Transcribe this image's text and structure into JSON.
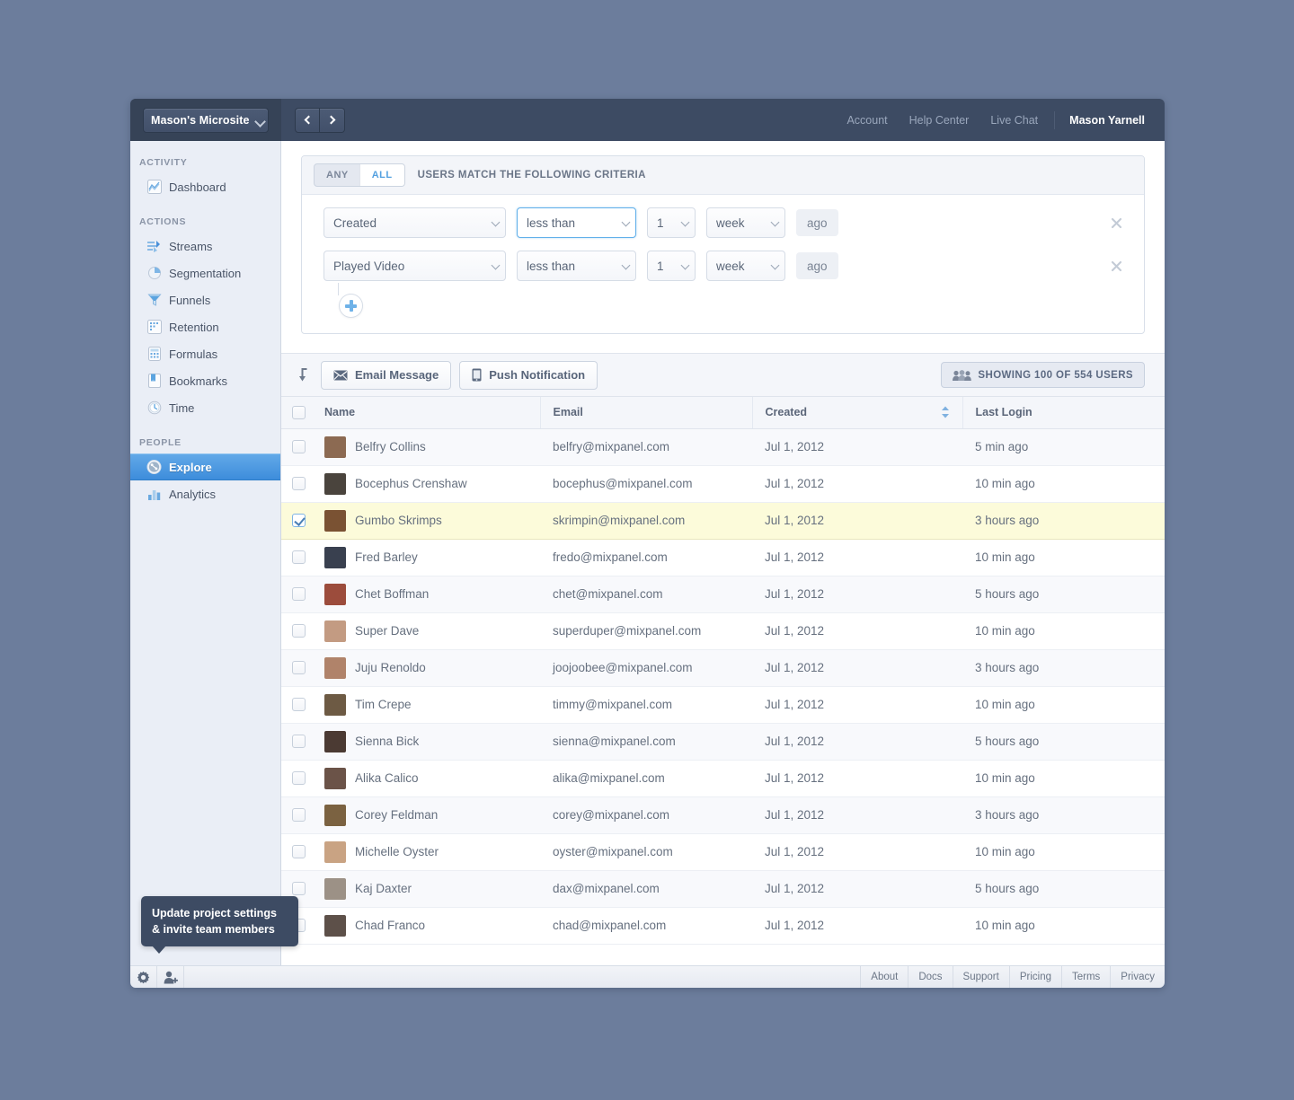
{
  "topbar": {
    "project_name": "Mason's Microsite",
    "nav_links": [
      "Account",
      "Help Center",
      "Live Chat"
    ],
    "user_name": "Mason Yarnell",
    "prev_icon": "chevron-left-icon",
    "next_icon": "chevron-right-icon"
  },
  "sidebar": {
    "groups": [
      {
        "title": "ACTIVITY",
        "items": [
          {
            "label": "Dashboard",
            "icon": "dashboard-chart-icon",
            "active": false
          }
        ]
      },
      {
        "title": "ACTIONS",
        "items": [
          {
            "label": "Streams",
            "icon": "streams-icon",
            "active": false
          },
          {
            "label": "Segmentation",
            "icon": "pie-chart-icon",
            "active": false
          },
          {
            "label": "Funnels",
            "icon": "funnel-icon",
            "active": false
          },
          {
            "label": "Retention",
            "icon": "grid-icon",
            "active": false
          },
          {
            "label": "Formulas",
            "icon": "calculator-icon",
            "active": false
          },
          {
            "label": "Bookmarks",
            "icon": "bookmark-icon",
            "active": false
          },
          {
            "label": "Time",
            "icon": "clock-icon",
            "active": false
          }
        ]
      },
      {
        "title": "PEOPLE",
        "items": [
          {
            "label": "Explore",
            "icon": "explore-icon",
            "active": true
          },
          {
            "label": "Analytics",
            "icon": "bar-chart-icon",
            "active": false
          }
        ]
      }
    ]
  },
  "criteria": {
    "match_any_label": "ANY",
    "match_all_label": "ALL",
    "selected_match": "ALL",
    "headline": "USERS MATCH THE FOLLOWING CRITERIA",
    "add_icon": "plus-icon",
    "remove_icon": "close-icon",
    "rows": [
      {
        "property": "Created",
        "operator": "less than",
        "number": "1",
        "unit": "week",
        "suffix": "ago",
        "focused": true
      },
      {
        "property": "Played Video",
        "operator": "less than",
        "number": "1",
        "unit": "week",
        "suffix": "ago",
        "focused": false
      }
    ]
  },
  "toolbar": {
    "sort_icon": "arrow-into-icon",
    "email_button": "Email Message",
    "email_icon": "envelope-icon",
    "push_button": "Push Notification",
    "push_icon": "mobile-phone-icon",
    "showing_label": "SHOWING 100 OF 554 USERS",
    "showing_icon": "people-icon"
  },
  "table": {
    "columns": [
      "Name",
      "Email",
      "Created",
      "Last Login"
    ],
    "sort_icon": "sort-updown-icon",
    "rows": [
      {
        "name": "Belfry Collins",
        "email": "belfry@mixpanel.com",
        "created": "Jul 1, 2012",
        "last_login": "5 min ago",
        "selected": false,
        "avatar": "#8c6a52"
      },
      {
        "name": "Bocephus Crenshaw",
        "email": "bocephus@mixpanel.com",
        "created": "Jul 1, 2012",
        "last_login": "10 min ago",
        "selected": false,
        "avatar": "#4a443d"
      },
      {
        "name": "Gumbo Skrimps",
        "email": "skrimpin@mixpanel.com",
        "created": "Jul 1, 2012",
        "last_login": "3 hours ago",
        "selected": true,
        "avatar": "#7a5233"
      },
      {
        "name": "Fred Barley",
        "email": "fredo@mixpanel.com",
        "created": "Jul 1, 2012",
        "last_login": "10 min ago",
        "selected": false,
        "avatar": "#39404f"
      },
      {
        "name": "Chet Boffman",
        "email": "chet@mixpanel.com",
        "created": "Jul 1, 2012",
        "last_login": "5 hours ago",
        "selected": false,
        "avatar": "#9c4c3c"
      },
      {
        "name": "Super Dave",
        "email": "superduper@mixpanel.com",
        "created": "Jul 1, 2012",
        "last_login": "10 min ago",
        "selected": false,
        "avatar": "#c39b82"
      },
      {
        "name": "Juju Renoldo",
        "email": "joojoobee@mixpanel.com",
        "created": "Jul 1, 2012",
        "last_login": "3 hours ago",
        "selected": false,
        "avatar": "#b0836a"
      },
      {
        "name": "Tim Crepe",
        "email": "timmy@mixpanel.com",
        "created": "Jul 1, 2012",
        "last_login": "10 min ago",
        "selected": false,
        "avatar": "#6d5a44"
      },
      {
        "name": "Sienna Bick",
        "email": "sienna@mixpanel.com",
        "created": "Jul 1, 2012",
        "last_login": "5 hours ago",
        "selected": false,
        "avatar": "#4b3a33"
      },
      {
        "name": "Alika Calico",
        "email": "alika@mixpanel.com",
        "created": "Jul 1, 2012",
        "last_login": "10 min ago",
        "selected": false,
        "avatar": "#6b5348"
      },
      {
        "name": "Corey Feldman",
        "email": "corey@mixpanel.com",
        "created": "Jul 1, 2012",
        "last_login": "3 hours ago",
        "selected": false,
        "avatar": "#7b6241"
      },
      {
        "name": "Michelle Oyster",
        "email": "oyster@mixpanel.com",
        "created": "Jul 1, 2012",
        "last_login": "10 min ago",
        "selected": false,
        "avatar": "#c9a383"
      },
      {
        "name": "Kaj Daxter",
        "email": "dax@mixpanel.com",
        "created": "Jul 1, 2012",
        "last_login": "5 hours ago",
        "selected": false,
        "avatar": "#9c9186"
      },
      {
        "name": "Chad Franco",
        "email": "chad@mixpanel.com",
        "created": "Jul 1, 2012",
        "last_login": "10 min ago",
        "selected": false,
        "avatar": "#5d5049"
      }
    ]
  },
  "tooltip": {
    "line1": "Update project settings",
    "line2": "& invite team members"
  },
  "footer": {
    "settings_icon": "gear-icon",
    "invite_icon": "add-user-icon",
    "links": [
      "About",
      "Docs",
      "Support",
      "Pricing",
      "Terms",
      "Privacy"
    ]
  },
  "colors": {
    "accent": "#4a95dd",
    "topbar": "#3d4b63",
    "sidebar": "#eaeef6",
    "selected_row": "#fcfbda",
    "page_background": "#6c7d9c"
  }
}
